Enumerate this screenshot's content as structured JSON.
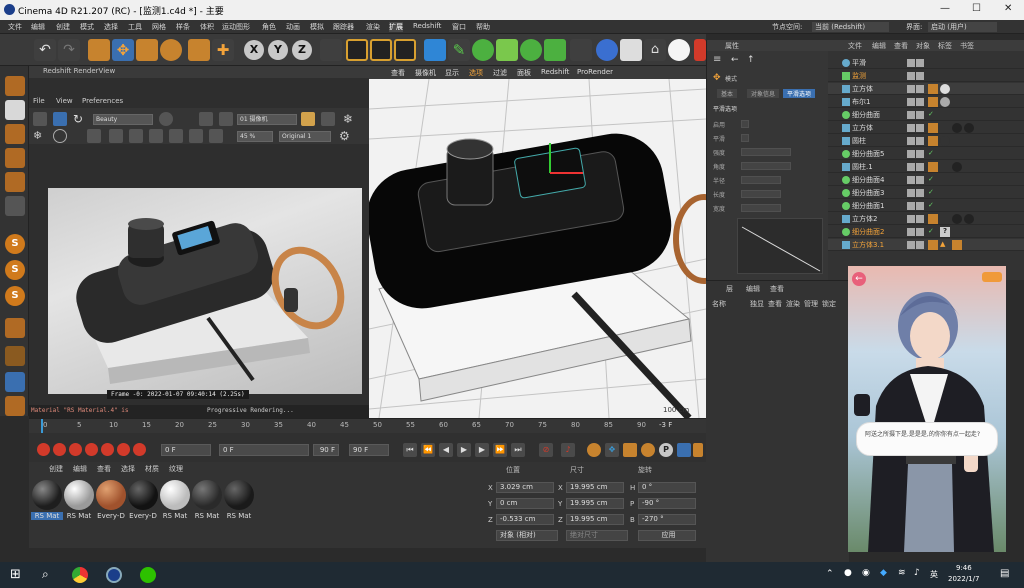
{
  "window": {
    "title": "Cinema 4D R21.207 (RC) - [监测1.c4d *] - 主要",
    "min": "—",
    "max": "☐",
    "close": "✕"
  },
  "menubar": {
    "items": [
      "文件",
      "编辑",
      "创建",
      "模式",
      "选择",
      "工具",
      "网格",
      "样条",
      "体积",
      "运动图形",
      "角色",
      "动画",
      "模拟",
      "跟踪器",
      "渲染",
      "扩展",
      "Redshift",
      "窗口",
      "帮助"
    ],
    "node_space_label": "节点空间:",
    "node_space_value": "当前 (Redshift)",
    "layout_label": "界面:",
    "layout_value": "启动 (用户)"
  },
  "toolbar": {
    "axes": [
      "X",
      "Y",
      "Z"
    ]
  },
  "renderview": {
    "title": "Redshift RenderView",
    "menu": [
      "File",
      "View",
      "Preferences"
    ],
    "beauty": "Beauty",
    "camera": "01 摄像机",
    "zoom": "45 %",
    "mode": "Original 1",
    "status": "Frame -0:  2022-01-07  09:40:14  (2.25s)",
    "bottom_left": "Material \"RS Material.4\" is",
    "bottom_mid": "Progressive Rendering..."
  },
  "viewport": {
    "menu": [
      "查看",
      "摄像机",
      "显示",
      "选项",
      "过滤",
      "面板",
      "Redshift",
      "ProRender"
    ],
    "grid_label": "100 cm"
  },
  "timeline": {
    "ticks": [
      "0",
      "5",
      "10",
      "15",
      "20",
      "25",
      "30",
      "35",
      "40",
      "45",
      "50",
      "55",
      "60",
      "65",
      "70",
      "75",
      "80",
      "85",
      "90"
    ],
    "end_frame": "-3 F",
    "start": "0 F",
    "cur": "0 F",
    "end": "90 F",
    "end2": "90 F"
  },
  "materials": {
    "tabs": [
      "创建",
      "编辑",
      "查看",
      "选择",
      "材质",
      "纹理"
    ],
    "items": [
      {
        "label": "RS Mat",
        "color": "#1e1e1e"
      },
      {
        "label": "RS Mat",
        "color": "#9a9a9a"
      },
      {
        "label": "Every-D",
        "color": "#a0522d"
      },
      {
        "label": "Every-D",
        "color": "#121212"
      },
      {
        "label": "RS Mat",
        "color": "#bcbcbc"
      },
      {
        "label": "RS Mat",
        "color": "#2a2a2a"
      },
      {
        "label": "RS Mat",
        "color": "#1a1a1a"
      }
    ]
  },
  "coords": {
    "headers": [
      "位置",
      "尺寸",
      "旋转"
    ],
    "rows": [
      {
        "axis": "X",
        "pos": "3.029 cm",
        "size": "19.995 cm",
        "rot_axis": "H",
        "rot": "0 °"
      },
      {
        "axis": "Y",
        "pos": "0 cm",
        "size": "19.995 cm",
        "rot_axis": "P",
        "rot": "-90 °"
      },
      {
        "axis": "Z",
        "pos": "-0.533 cm",
        "size": "19.995 cm",
        "rot_axis": "B",
        "rot": "-270 °"
      }
    ],
    "mode": "对象 (相对)",
    "size_mode": "绝对尺寸",
    "apply": "应用"
  },
  "attributes": {
    "title": "属性",
    "mode_label": "模式",
    "tabs": [
      "基本",
      "对象信息",
      "平滑选项"
    ],
    "section": "平滑选项",
    "rows": [
      "启用",
      "平滑",
      "强度",
      "角度",
      "半径",
      "长度",
      "宽度"
    ]
  },
  "objects": {
    "tabs": [
      "文件",
      "编辑",
      "查看",
      "对象",
      "标签",
      "书签"
    ],
    "rows": [
      {
        "name": "平滑",
        "tags": 1,
        "color": "#6ac"
      },
      {
        "name": "监测",
        "tags": 2,
        "color": "#6c6"
      },
      {
        "name": "立方体",
        "tags": 3,
        "color": "#6ac"
      },
      {
        "name": "布尔1",
        "tags": 2,
        "color": "#6ac"
      },
      {
        "name": "细分曲面",
        "tags": 1,
        "color": "#6c6"
      },
      {
        "name": "立方体",
        "tags": 3,
        "color": "#6ac"
      },
      {
        "name": "圆柱",
        "tags": 2,
        "color": "#6ac"
      },
      {
        "name": "细分曲面5",
        "tags": 1,
        "color": "#6c6"
      },
      {
        "name": "圆柱.1",
        "tags": 3,
        "color": "#6ac"
      },
      {
        "name": "细分曲面4",
        "tags": 1,
        "color": "#6c6"
      },
      {
        "name": "细分曲面3",
        "tags": 1,
        "color": "#6c6"
      },
      {
        "name": "细分曲面1",
        "tags": 1,
        "color": "#6c6"
      },
      {
        "name": "立方体2",
        "tags": 3,
        "color": "#6ac"
      },
      {
        "name": "细分曲面2",
        "tags": 2,
        "color": "#6c6"
      },
      {
        "name": "立方体3.1",
        "tags": 3,
        "color": "#6ac"
      }
    ]
  },
  "layers": {
    "tabs": [
      "层",
      "编辑",
      "查看"
    ],
    "cols": [
      "名称",
      "独显",
      "查看",
      "渲染",
      "管理",
      "锁定",
      "动画",
      "生成器"
    ]
  },
  "game": {
    "dialog": "阿送之所摄下是,是是是,的你你有点一起走?"
  },
  "taskbar": {
    "time": "9:46",
    "date": "2022/1/7",
    "lang": "英"
  }
}
